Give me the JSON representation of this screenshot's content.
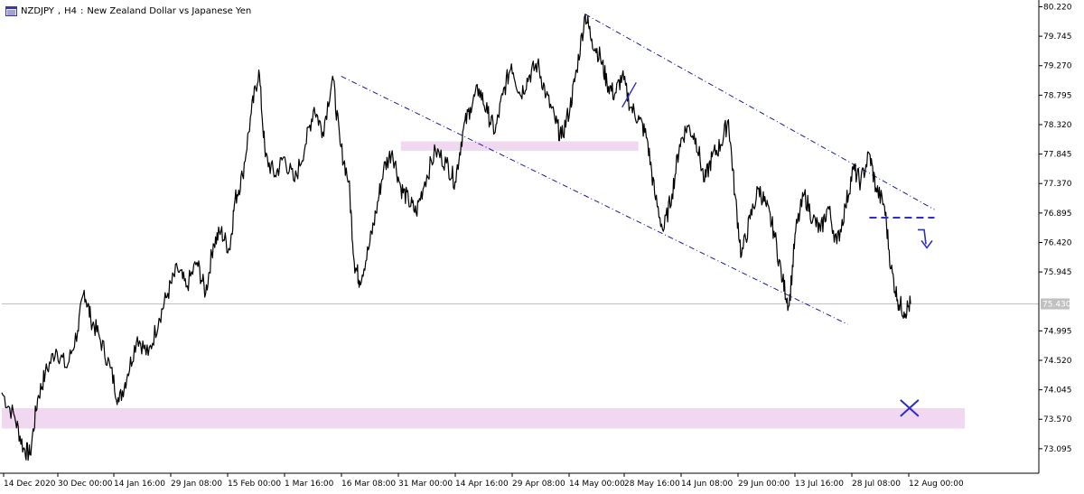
{
  "header": {
    "symbol": "NZDJPY",
    "timeframe": "H4",
    "description": "New Zealand Dollar vs Japanese Yen",
    "icon": "chart-window-icon"
  },
  "colors": {
    "price": "#000000",
    "trendline": "#1a1aa6",
    "zone": "#f0d8f0",
    "marker": "#2d2dc8",
    "axis": "#000000",
    "current_line": "#c0c0c0",
    "current_label_bg": "#c0c0c0"
  },
  "chart_data": {
    "type": "line",
    "title": "",
    "xlabel": "",
    "ylabel": "",
    "x_ticks": [
      "14 Dec 2020",
      "30 Dec 00:00",
      "14 Jan 16:00",
      "29 Jan 08:00",
      "15 Feb 00:00",
      "1 Mar 16:00",
      "16 Mar 08:00",
      "31 Mar 00:00",
      "14 Apr 16:00",
      "29 Apr 08:00",
      "14 May 00:00",
      "28 May 16:00",
      "14 Jun 08:00",
      "29 Jun 00:00",
      "13 Jul 16:00",
      "28 Jul 08:00",
      "12 Aug 00:00"
    ],
    "y_ticks": [
      73.095,
      73.57,
      74.045,
      74.52,
      74.995,
      75.945,
      76.42,
      76.895,
      77.37,
      77.845,
      78.32,
      78.795,
      79.27,
      79.745,
      80.22
    ],
    "y_tick_labels": [
      "73.095",
      "73.570",
      "74.045",
      "74.520",
      "74.995",
      "75.945",
      "76.420",
      "76.895",
      "77.370",
      "77.845",
      "78.320",
      "78.795",
      "79.270",
      "79.745",
      "80.220"
    ],
    "ylim": [
      72.7,
      80.3
    ],
    "current_price": 75.43,
    "current_price_label": "75.430",
    "grid": false,
    "series": [
      {
        "points": [
          [
            0,
            74.0
          ],
          [
            1.2,
            73.6
          ],
          [
            2.0,
            73.1
          ],
          [
            2.6,
            73.0
          ],
          [
            3.3,
            73.9
          ],
          [
            4.0,
            74.3
          ],
          [
            5.0,
            74.7
          ],
          [
            6.0,
            74.4
          ],
          [
            7.0,
            75.0
          ],
          [
            7.6,
            75.65
          ],
          [
            8.2,
            75.2
          ],
          [
            9.0,
            74.9
          ],
          [
            10.0,
            74.4
          ],
          [
            10.8,
            73.85
          ],
          [
            11.6,
            74.3
          ],
          [
            12.5,
            74.9
          ],
          [
            13.5,
            74.6
          ],
          [
            14.5,
            75.2
          ],
          [
            15.3,
            75.6
          ],
          [
            16.2,
            76.0
          ],
          [
            17.0,
            75.7
          ],
          [
            18.0,
            76.1
          ],
          [
            18.8,
            75.6
          ],
          [
            19.5,
            76.4
          ],
          [
            20.2,
            76.6
          ],
          [
            21.0,
            76.3
          ],
          [
            21.5,
            77.1
          ],
          [
            22.2,
            77.5
          ],
          [
            23.0,
            78.5
          ],
          [
            23.7,
            79.2
          ],
          [
            24.3,
            77.8
          ],
          [
            25.2,
            77.5
          ],
          [
            26.0,
            77.8
          ],
          [
            27.0,
            77.4
          ],
          [
            28.0,
            78.0
          ],
          [
            28.8,
            78.6
          ],
          [
            29.6,
            78.2
          ],
          [
            30.5,
            79.1
          ],
          [
            31.2,
            78.0
          ],
          [
            32.0,
            77.4
          ],
          [
            32.5,
            76.1
          ],
          [
            33.0,
            75.8
          ],
          [
            33.8,
            76.3
          ],
          [
            34.5,
            76.9
          ],
          [
            35.2,
            77.6
          ],
          [
            36.0,
            77.9
          ],
          [
            36.8,
            77.3
          ],
          [
            37.5,
            77.1
          ],
          [
            38.2,
            76.9
          ],
          [
            39.0,
            77.4
          ],
          [
            40.0,
            77.9
          ],
          [
            41.0,
            77.7
          ],
          [
            41.8,
            77.4
          ],
          [
            42.5,
            78.2
          ],
          [
            43.2,
            78.6
          ],
          [
            44.0,
            78.9
          ],
          [
            44.8,
            78.5
          ],
          [
            45.5,
            78.2
          ],
          [
            46.2,
            78.8
          ],
          [
            47.0,
            79.3
          ],
          [
            47.8,
            78.8
          ],
          [
            48.6,
            79.1
          ],
          [
            49.4,
            79.3
          ],
          [
            50.2,
            78.8
          ],
          [
            51.0,
            78.4
          ],
          [
            51.6,
            78.1
          ],
          [
            52.4,
            78.6
          ],
          [
            53.0,
            79.2
          ],
          [
            53.8,
            80.1
          ],
          [
            54.4,
            79.7
          ],
          [
            55.2,
            79.4
          ],
          [
            55.8,
            79.0
          ],
          [
            56.5,
            78.8
          ],
          [
            57.2,
            79.1
          ],
          [
            58.0,
            78.6
          ],
          [
            58.8,
            78.4
          ],
          [
            59.5,
            78.1
          ],
          [
            60.2,
            77.2
          ],
          [
            61.0,
            76.6
          ],
          [
            61.8,
            77.2
          ],
          [
            62.5,
            78.0
          ],
          [
            63.2,
            78.3
          ],
          [
            64.0,
            78.1
          ],
          [
            64.8,
            77.4
          ],
          [
            65.5,
            77.8
          ],
          [
            66.3,
            78.0
          ],
          [
            67.0,
            78.4
          ],
          [
            67.6,
            77.2
          ],
          [
            68.2,
            76.2
          ],
          [
            69.0,
            76.8
          ],
          [
            69.8,
            77.3
          ],
          [
            70.5,
            77.0
          ],
          [
            71.2,
            76.6
          ],
          [
            72.0,
            75.8
          ],
          [
            72.6,
            75.4
          ],
          [
            73.2,
            76.6
          ],
          [
            74.0,
            77.2
          ],
          [
            74.8,
            76.8
          ],
          [
            75.5,
            76.6
          ],
          [
            76.2,
            77.0
          ],
          [
            77.0,
            76.4
          ],
          [
            77.8,
            77.0
          ],
          [
            78.5,
            77.6
          ],
          [
            79.2,
            77.4
          ],
          [
            80.0,
            77.85
          ],
          [
            80.6,
            77.3
          ],
          [
            81.4,
            77.0
          ],
          [
            82.0,
            76.0
          ],
          [
            82.6,
            75.5
          ],
          [
            83.2,
            75.3
          ],
          [
            83.8,
            75.43
          ]
        ]
      }
    ],
    "trendlines": [
      {
        "x1": 31.3,
        "y1": 79.1,
        "x2": 78.0,
        "y2": 75.1
      },
      {
        "x1": 53.8,
        "y1": 80.1,
        "x2": 86.0,
        "y2": 76.95
      }
    ],
    "zones": [
      {
        "x1": 36.8,
        "x2": 58.7,
        "y1": 77.9,
        "y2": 78.05
      },
      {
        "x1": 0.0,
        "x2": 88.8,
        "y1": 73.42,
        "y2": 73.75
      }
    ],
    "horizontal_markers": [
      {
        "x1": 80.0,
        "x2": 86.0,
        "y": 76.82
      }
    ],
    "annotations": [
      {
        "type": "down-arrow",
        "x": 85.3,
        "y": 76.45
      },
      {
        "type": "cross",
        "x": 83.7,
        "y": 73.75
      },
      {
        "type": "small-rising-line",
        "x1": 57.2,
        "y1": 78.6,
        "x2": 58.5,
        "y2": 79.0
      }
    ]
  }
}
